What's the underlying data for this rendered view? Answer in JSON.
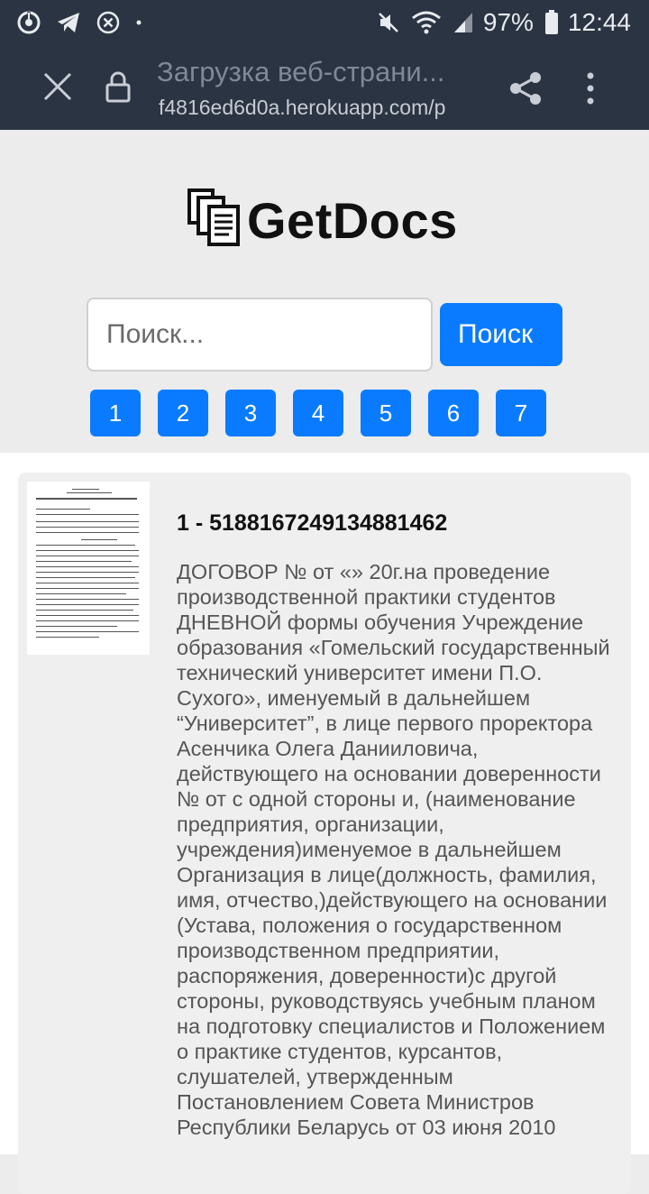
{
  "status_bar": {
    "battery": "97%",
    "time": "12:44"
  },
  "browser": {
    "page_title": "Загрузка веб-страни...",
    "url": "f4816ed6d0a.herokuapp.com/p"
  },
  "site": {
    "logo_text": "GetDocs",
    "search": {
      "placeholder": "Поиск...",
      "value": "",
      "button_label": "Поиск"
    },
    "pagination": [
      "1",
      "2",
      "3",
      "4",
      "5",
      "6",
      "7"
    ]
  },
  "results": [
    {
      "title": "1 - 5188167249134881462",
      "snippet": "ДОГОВОР № от «» 20г.на проведение производственной практики студентов ДНЕВНОЙ формы обучения Учреждение образования «Гомельский государственный технический университет имени П.О. Сухого», именуемый в дальнейшем “Университет”, в лице первого проректора Асенчика Олега Данииловича, действующего на основании доверенности № от с одной стороны и, (наименование предприятия, организации, учреждения)именуемое в дальнейшем Организация в лице(должность, фамилия, имя, отчество,)действующего на основании (Устава, положения о государственном производственном предприятии, распоряжения, доверенности)с другой стороны, руководствуясь учебным планом на подготовку специалистов и Положением о практике студентов, курсантов, слушателей, утвержденным Постановлением Совета Министров Республики Беларусь от 03 июня 2010"
    }
  ]
}
